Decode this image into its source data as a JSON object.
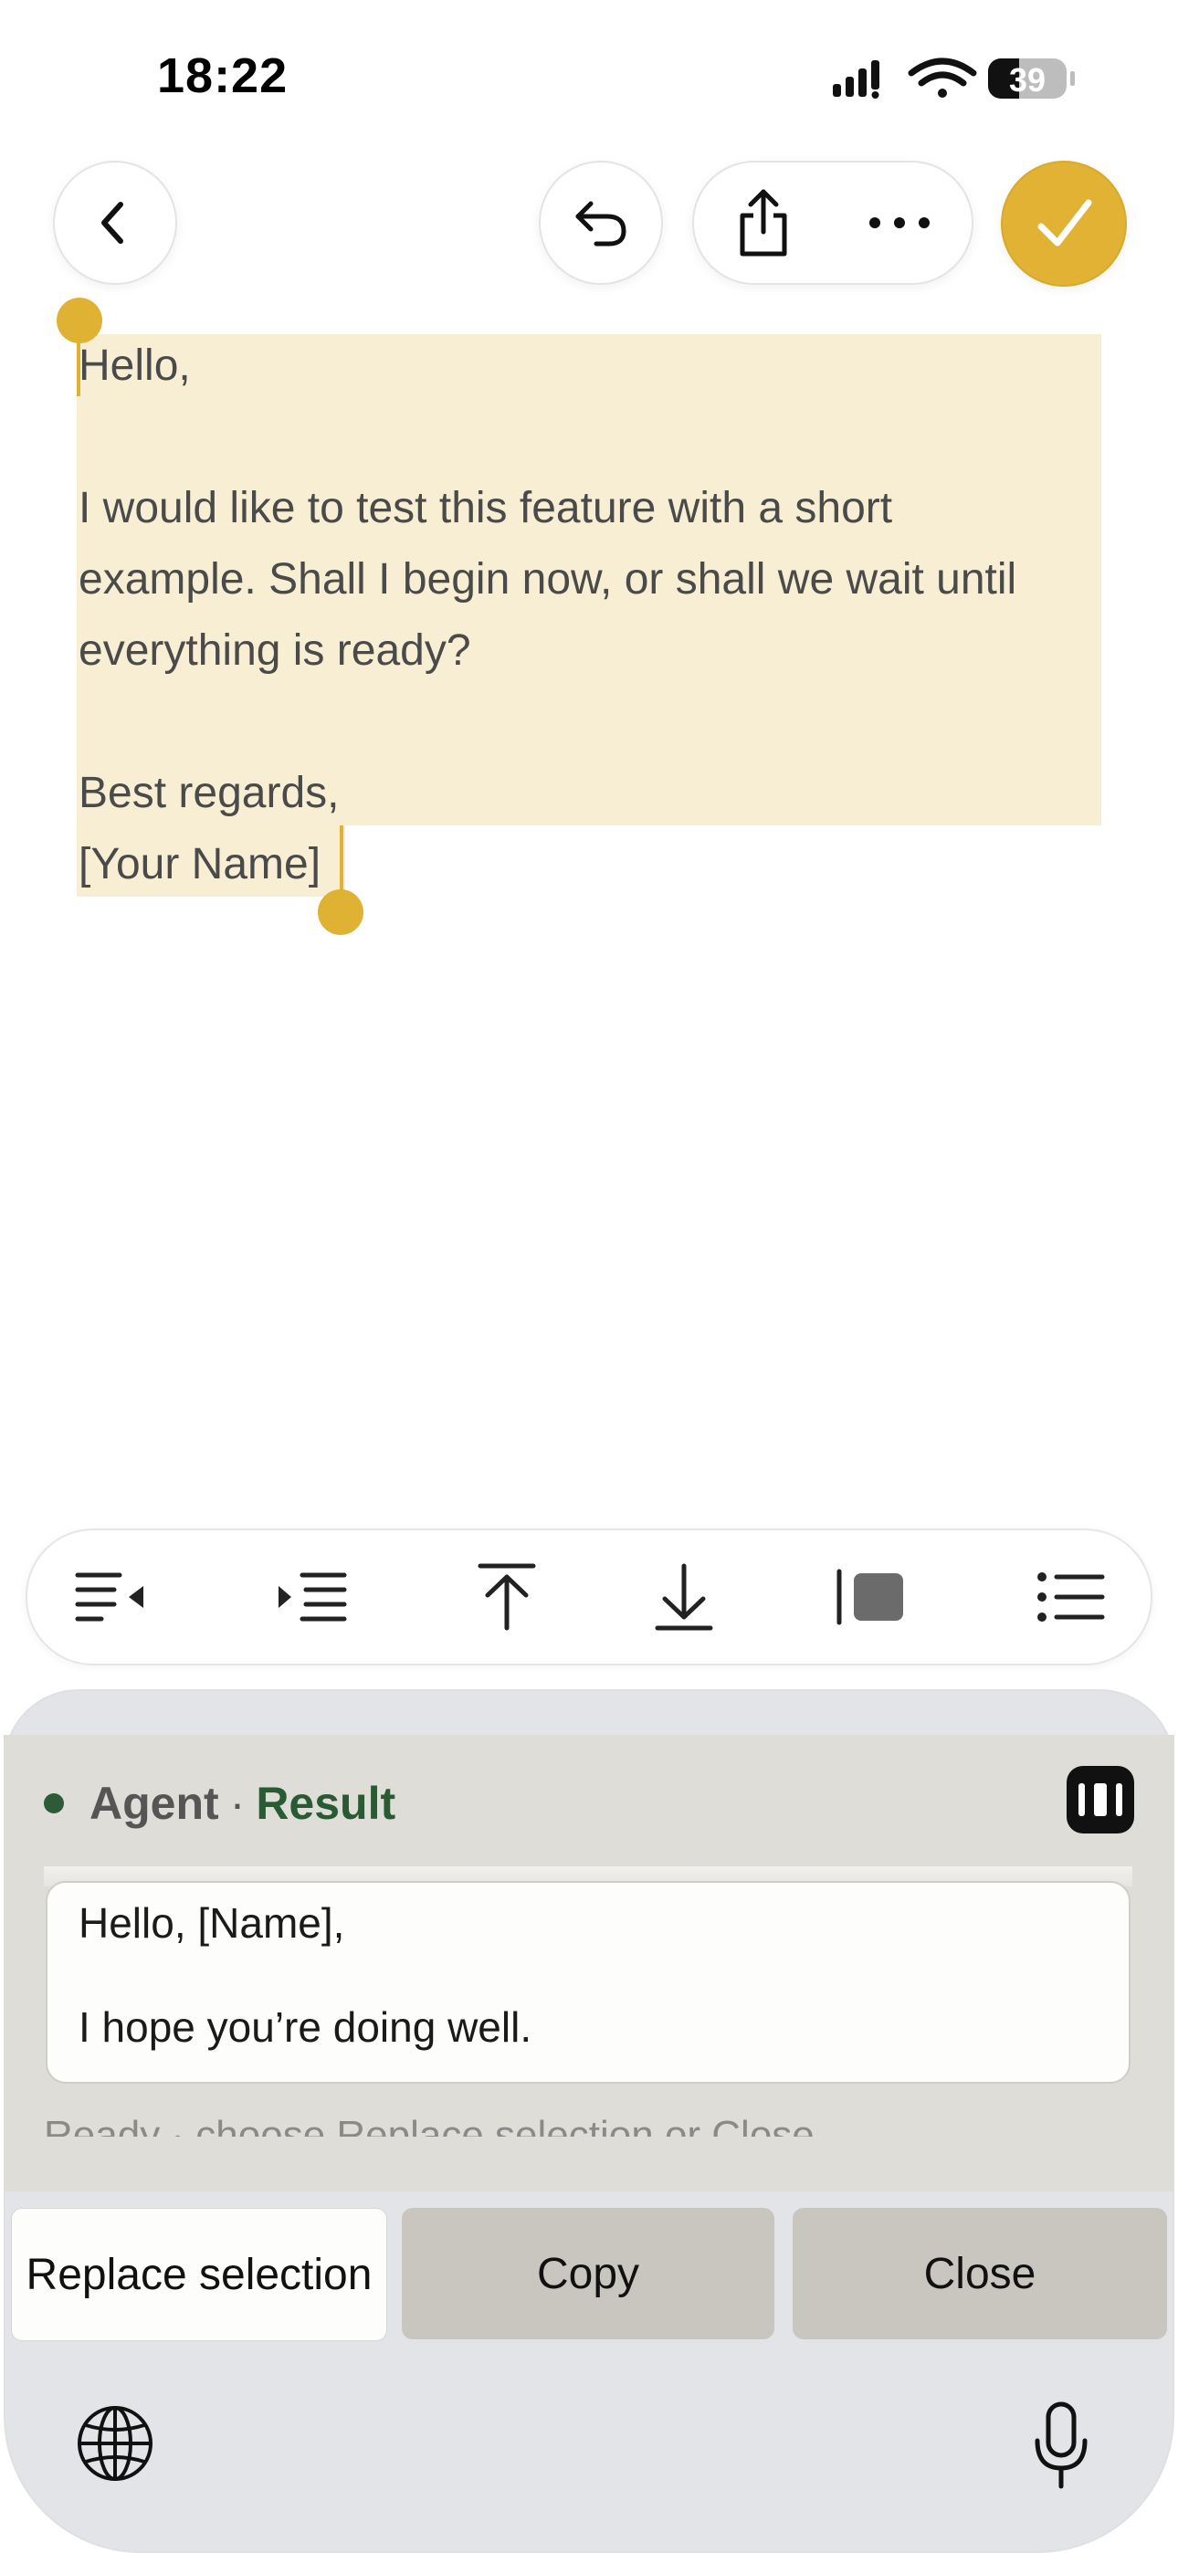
{
  "status_bar": {
    "time": "18:22",
    "battery": "39",
    "icons": [
      "signal-icon",
      "wifi-icon",
      "battery-icon"
    ]
  },
  "toolbar": {
    "buttons": [
      "back-icon",
      "undo-icon",
      "share-icon",
      "more-icon",
      "checkmark-icon"
    ],
    "accent_color": "#e1b233"
  },
  "document": {
    "lines": [
      "Hello,",
      "",
      "I would like to test this feature with a short",
      "example. Shall I begin now, or shall we wait until",
      "everything is ready?",
      "",
      "Best regards,",
      "[Your Name]"
    ],
    "selection_color": "#f7eed3"
  },
  "format_toolbar": {
    "buttons": [
      "outdent-icon",
      "indent-icon",
      "move-to-top-icon",
      "move-to-bottom-icon",
      "block-quote-icon",
      "bullet-list-icon"
    ]
  },
  "agent": {
    "label": "Agent",
    "separator": "·",
    "state": "Result",
    "result_lines": [
      "Hello, [Name],",
      "I hope you’re doing well."
    ],
    "status_text": "Ready · choose Replace selection or Close",
    "actions": {
      "replace": "Replace selection",
      "copy": "Copy",
      "close": "Close"
    }
  },
  "keyboard": {
    "icons": [
      "globe-icon",
      "microphone-icon"
    ]
  }
}
